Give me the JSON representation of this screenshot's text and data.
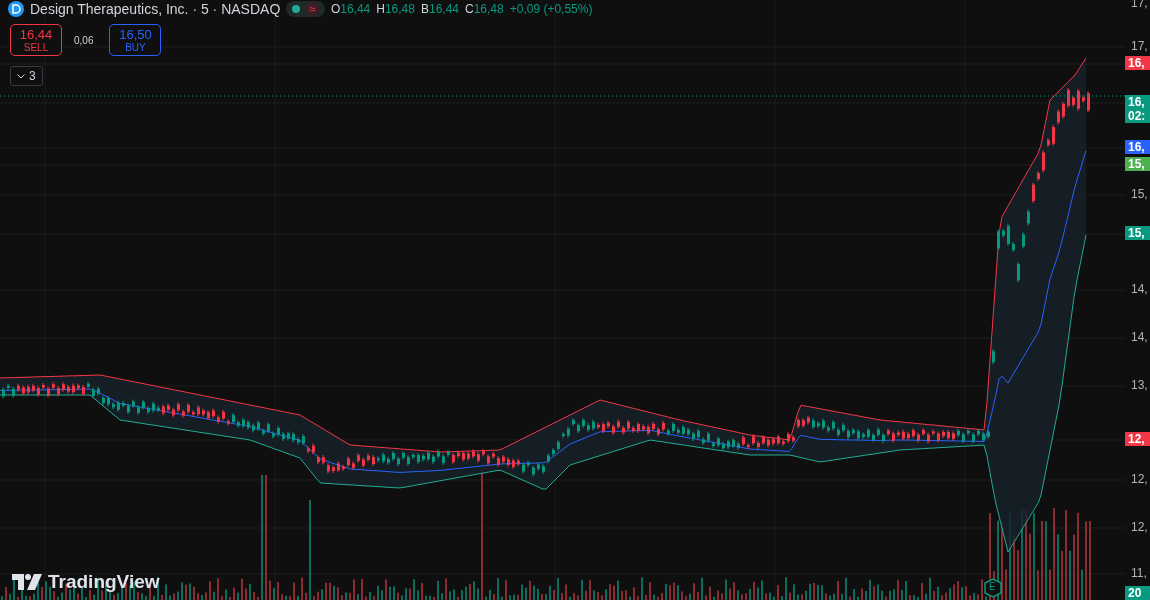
{
  "header": {
    "title": "Design Therapeutics, Inc. · 5 · NASDAQ",
    "status_glyph": "≈",
    "ohlc": [
      {
        "label": "O",
        "value": "16,44"
      },
      {
        "label": "H",
        "value": "16,48"
      },
      {
        "label": "B",
        "value": "16,44"
      },
      {
        "label": "C",
        "value": "16,48"
      }
    ],
    "change": "+0,09 (+0,55%)"
  },
  "trade": {
    "sell": {
      "price": "16,44",
      "label": "SELL"
    },
    "spread": "0,06",
    "buy": {
      "price": "16,50",
      "label": "BUY"
    }
  },
  "indicators_toggle": {
    "count": "3"
  },
  "price_axis": [
    {
      "kind": "tick",
      "text": "17,"
    },
    {
      "kind": "tick",
      "text": "17,"
    },
    {
      "kind": "badge",
      "text": "16,",
      "color": "#f23645"
    },
    {
      "kind": "badge",
      "text": "16,",
      "sub": "02:",
      "color": "#089981"
    },
    {
      "kind": "badge",
      "text": "16,",
      "color": "#2962ff"
    },
    {
      "kind": "badge",
      "text": "15,",
      "color": "#4caf50"
    },
    {
      "kind": "tick",
      "text": "15,"
    },
    {
      "kind": "badge",
      "text": "15,",
      "color": "#089981"
    },
    {
      "kind": "tick",
      "text": "14,"
    },
    {
      "kind": "tick",
      "text": "14,"
    },
    {
      "kind": "tick",
      "text": "13,"
    },
    {
      "kind": "badge",
      "text": "12,",
      "color": "#f23645"
    },
    {
      "kind": "tick",
      "text": "12,"
    },
    {
      "kind": "tick",
      "text": "12,"
    },
    {
      "kind": "tick",
      "text": "11,"
    },
    {
      "kind": "badge",
      "text": "20",
      "color": "#089981"
    }
  ],
  "earnings_marker": {
    "text": "E"
  },
  "logo": {
    "text": "TradingView"
  }
}
